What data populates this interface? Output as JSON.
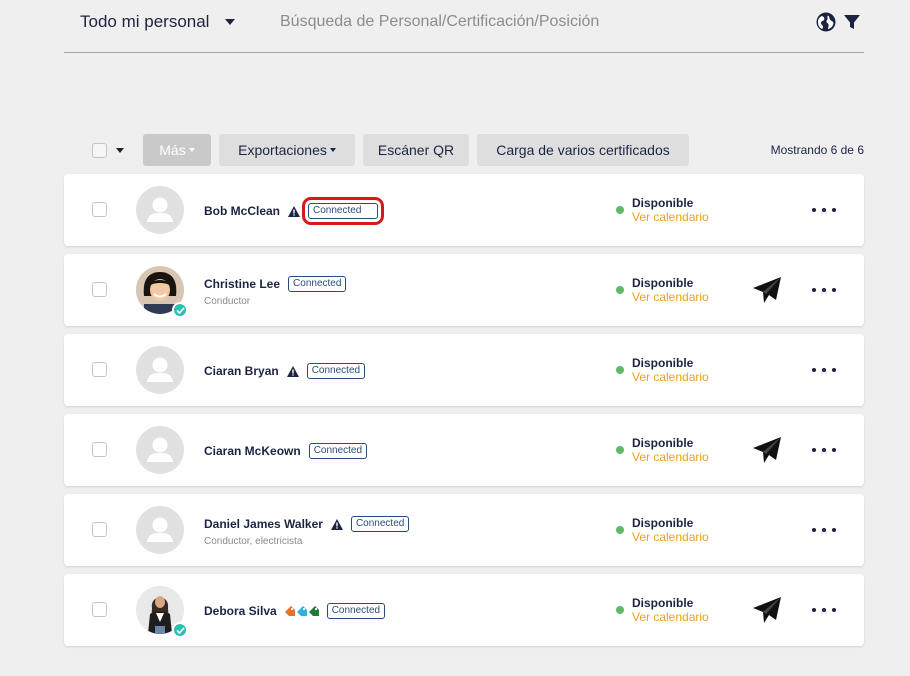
{
  "header": {
    "team_filter": "Todo mi personal",
    "search_placeholder": "Búsqueda de Personal/Certificación/Posición",
    "icons": [
      "globe-icon",
      "filter-icon"
    ]
  },
  "toolbar": {
    "more_label": "Más",
    "exports_label": "Exportaciones",
    "qr_label": "Escáner QR",
    "bulk_upload_label": "Carga de varios certificados",
    "count_text": "Mostrando 6 de 6"
  },
  "colors": {
    "accent_orange": "#f0a11a",
    "available_green": "#5fbb6a",
    "highlight_red": "#d8191a",
    "verified_teal": "#2cc0b0",
    "text_navy": "#1c2442"
  },
  "people": [
    {
      "name": "Bob McClean",
      "role": "",
      "warning": true,
      "tags": [],
      "connected": "Connected",
      "status": "Disponible",
      "calendar": "Ver calendario",
      "photo": "placeholder",
      "verified": false,
      "send": false,
      "highlighted": true
    },
    {
      "name": "Christine Lee",
      "role": "Conductor",
      "warning": false,
      "tags": [],
      "connected": "Connected",
      "status": "Disponible",
      "calendar": "Ver calendario",
      "photo": "photo",
      "verified": true,
      "send": true,
      "highlighted": false
    },
    {
      "name": "Ciaran Bryan",
      "role": "",
      "warning": true,
      "tags": [],
      "connected": "Connected",
      "status": "Disponible",
      "calendar": "Ver calendario",
      "photo": "placeholder",
      "verified": false,
      "send": false,
      "highlighted": false
    },
    {
      "name": "Ciaran McKeown",
      "role": "",
      "warning": false,
      "tags": [],
      "connected": "Connected",
      "status": "Disponible",
      "calendar": "Ver calendario",
      "photo": "placeholder",
      "verified": false,
      "send": true,
      "highlighted": false
    },
    {
      "name": "Daniel James Walker",
      "role": "Conductor, electricista",
      "warning": true,
      "tags": [],
      "connected": "Connected",
      "status": "Disponible",
      "calendar": "Ver calendario",
      "photo": "placeholder",
      "verified": false,
      "send": false,
      "highlighted": false
    },
    {
      "name": "Debora Silva",
      "role": "",
      "warning": false,
      "tags": [
        "#e8712a",
        "#2bb3e0",
        "#1f7a3a"
      ],
      "connected": "Connected",
      "status": "Disponible",
      "calendar": "Ver calendario",
      "photo": "photo",
      "verified": true,
      "send": true,
      "highlighted": false
    }
  ]
}
